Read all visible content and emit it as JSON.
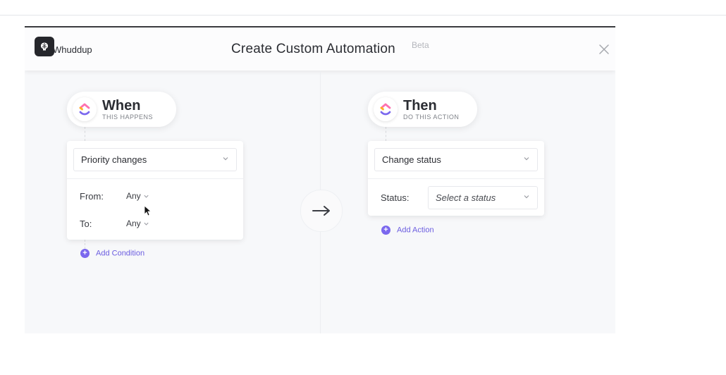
{
  "modal": {
    "brand": "Whuddup",
    "title": "Create Custom Automation",
    "badge": "Beta"
  },
  "trigger": {
    "title": "When",
    "subtitle": "THIS HAPPENS",
    "event": "Priority changes",
    "from_label": "From:",
    "from_value": "Any",
    "to_label": "To:",
    "to_value": "Any",
    "add_label": "Add Condition"
  },
  "action": {
    "title": "Then",
    "subtitle": "DO THIS ACTION",
    "event": "Change status",
    "status_label": "Status:",
    "status_placeholder": "Select a status",
    "add_label": "Add Action"
  },
  "colors": {
    "accent": "#7b68ee",
    "logo_purple": "#7b68ee",
    "logo_pink": "#fd71af",
    "logo_orange": "#ffb020"
  },
  "icons": {
    "brand": "brain-icon",
    "close": "close-icon",
    "arrow": "arrow-right-icon",
    "chevron": "chevron-down-icon",
    "add": "plus-circle-icon"
  }
}
